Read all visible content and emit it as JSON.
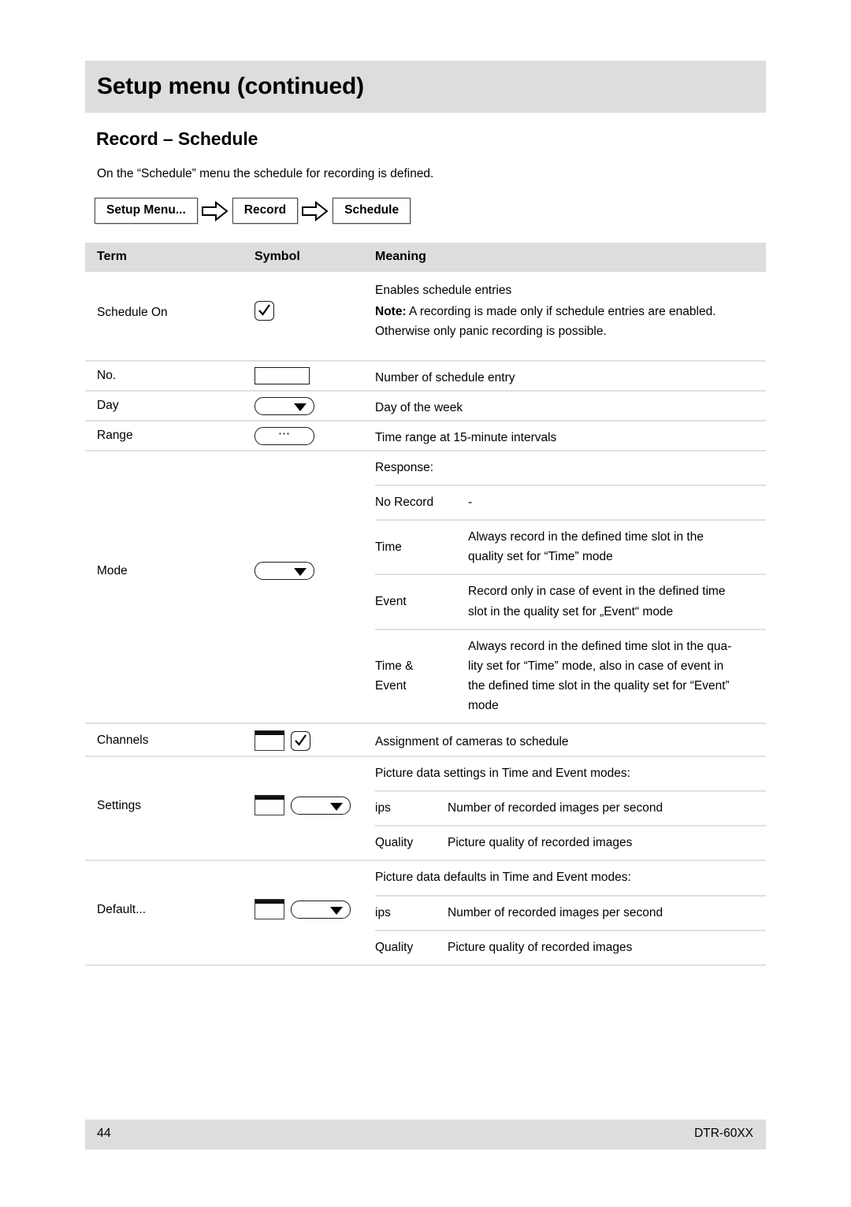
{
  "header": {
    "title": "Setup menu (continued)",
    "band_color": "#dcdddf"
  },
  "section": {
    "title": "Record – Schedule",
    "intro": "On the “Schedule” menu the schedule for recording is defined."
  },
  "breadcrumb": {
    "items": [
      {
        "label": "Setup Menu..."
      },
      {
        "label": "Record"
      },
      {
        "label": "Schedule"
      }
    ],
    "arrow_icon": "right-block-arrow-icon"
  },
  "table": {
    "columns": [
      "Term",
      "Symbol",
      "Meaning"
    ],
    "rows": [
      {
        "term": "Schedule On",
        "symbols": [
          "checkbox-checked"
        ],
        "meaning_lines": [
          "Enables schedule entries"
        ],
        "note_label": "Note:",
        "note_text": " A recording is made only if schedule entries are enabled. Otherwise only panic recording is possible."
      },
      {
        "term": "No.",
        "symbols": [
          "text-field"
        ],
        "meaning": "Number of schedule entry"
      },
      {
        "term": "Day",
        "symbols": [
          "dropdown"
        ],
        "meaning": "Day of the week"
      },
      {
        "term": "Range",
        "symbols": [
          "dots-button"
        ],
        "meaning": "Time range at 15-minute intervals"
      },
      {
        "term": "Mode",
        "symbols": [
          "dropdown"
        ],
        "meaning_header": "Response:",
        "sub_rows": [
          {
            "label": "No Record",
            "desc": "-"
          },
          {
            "label": "Time",
            "desc": "Always record in the defined time slot in the\nquality set for “Time” mode"
          },
          {
            "label": "Event",
            "desc": "Record only in case of event in the defined time\nslot in the quality set for „Event“ mode"
          },
          {
            "label": "Time &\nEvent",
            "desc": "Always record in the defined time slot in the qua-\nlity set for “Time” mode, also in case of event in\nthe defined time slot in the quality set for “Event”\nmode"
          }
        ]
      },
      {
        "term": "Channels",
        "symbols": [
          "window",
          "checkbox-checked"
        ],
        "meaning": "Assignment of cameras to schedule"
      },
      {
        "term": "Settings",
        "symbols": [
          "window",
          "dropdown"
        ],
        "meaning_header": "Picture data settings in Time and Event modes:",
        "sub_rows": [
          {
            "label": "ips",
            "desc": "Number of recorded images per second"
          },
          {
            "label": "Quality",
            "desc": "Picture quality of recorded images"
          }
        ]
      },
      {
        "term": "Default...",
        "symbols": [
          "window",
          "dropdown"
        ],
        "meaning_header": "Picture data defaults in Time and Event modes:",
        "sub_rows": [
          {
            "label": "ips",
            "desc": "Number of recorded images per second"
          },
          {
            "label": "Quality",
            "desc": "Picture quality of recorded images"
          }
        ]
      }
    ]
  },
  "footer": {
    "page_number": "44",
    "model": "DTR-60XX"
  }
}
